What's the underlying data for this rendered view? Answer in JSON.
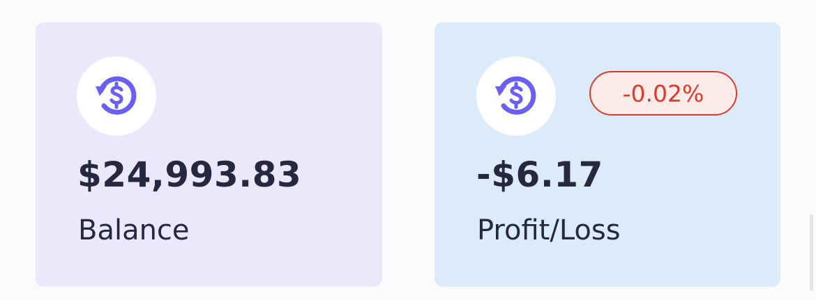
{
  "balance_card": {
    "icon": "dollar-refresh-icon",
    "amount": "$24,993.83",
    "label": "Balance"
  },
  "pnl_card": {
    "icon": "dollar-refresh-icon",
    "amount": "-$6.17",
    "label": "Profit/Loss",
    "change_badge": "-0.02%"
  },
  "colors": {
    "icon_accent": "#6a5ff0",
    "balance_card_bg": "#ebe8fb",
    "pnl_card_bg": "#dcebf9",
    "negative": "#dc3a2a",
    "text_primary": "#262840"
  }
}
